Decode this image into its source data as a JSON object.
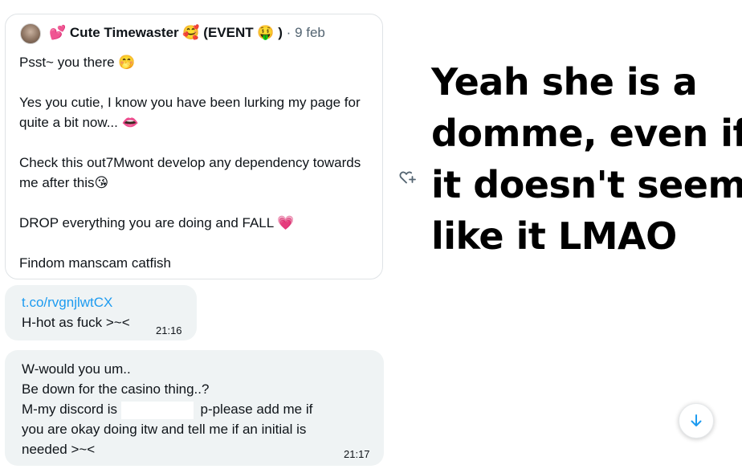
{
  "quoted_tweet": {
    "author_name": "Cute Timewaster",
    "author_tag": "(EVENT",
    "author_tag_close": ")",
    "separator": "·",
    "date": "9 feb",
    "paragraphs": [
      "Psst~ you there 🤭",
      "Yes you cutie, I know you have been lurking my page for quite a bit now... 👄",
      "Check this out7Mwont develop any dependency towards me after this😘",
      "DROP everything you are doing and FALL 💗",
      "Findom manscam catfish"
    ],
    "emojis": {
      "pre_name": "💕",
      "post_name": "🥰",
      "tag": "🤑"
    }
  },
  "messages": [
    {
      "link": "t.co/rvgnjlwtCX",
      "text": "H-hot as fuck >~<",
      "time": "21:16"
    },
    {
      "lines": [
        "W-would you um..",
        "Be down for the casino thing..?",
        "M-my discord is",
        "p-please add me if",
        "you are okay doing itw and tell me if an initial is",
        "needed >~<"
      ],
      "time": "21:17"
    }
  ],
  "meme": {
    "lines": [
      "Yeah she is a",
      "domme, even if",
      "it doesn't seem",
      "like it LMAO"
    ]
  },
  "icons": {
    "react": "add-reaction-icon",
    "scroll": "arrow-down-icon"
  },
  "colors": {
    "bubble": "#eff3f4",
    "link": "#1d9bf0",
    "muted": "#536471"
  }
}
